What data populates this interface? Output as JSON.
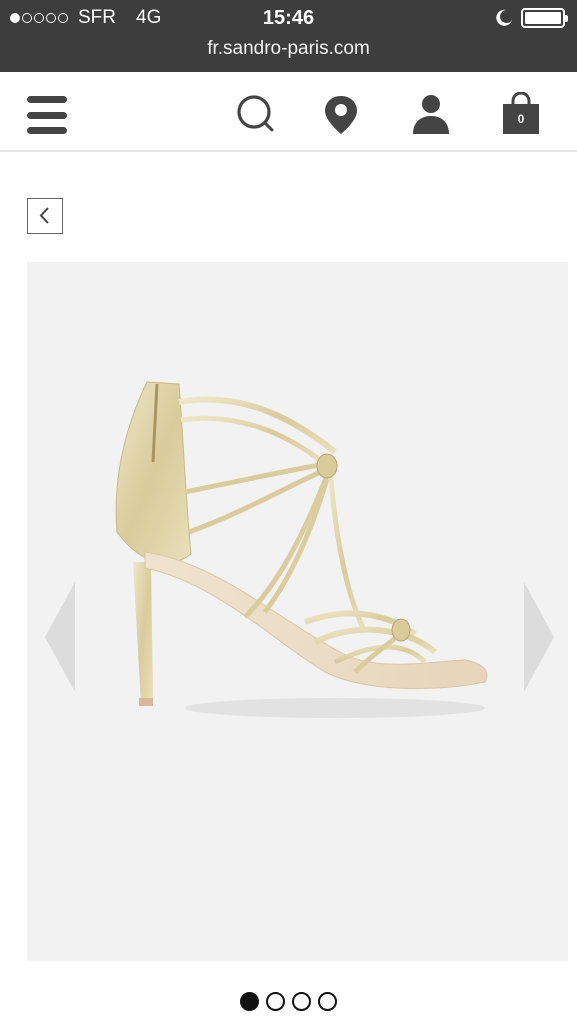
{
  "status_bar": {
    "signal_dots": [
      true,
      false,
      false,
      false,
      false
    ],
    "carrier": "SFR",
    "network": "4G",
    "time": "15:46",
    "do_not_disturb_icon": "moon-icon",
    "battery_level": 1.0
  },
  "browser": {
    "url": "fr.sandro-paris.com"
  },
  "header": {
    "menu_icon": "hamburger-menu-icon",
    "icons": [
      "search-icon",
      "store-locator-pin-icon",
      "account-icon",
      "shopping-bag-icon"
    ],
    "cart_count": "0"
  },
  "navigation": {
    "back_icon": "chevron-left-icon"
  },
  "gallery": {
    "image": "gold metallic strappy high-heel sandal",
    "prev_icon": "chevron-left-icon",
    "next_icon": "chevron-right-icon",
    "page_count": 4,
    "current_page": 1
  },
  "colors": {
    "status_bar_bg": "#3d3d3d",
    "icon_gray": "#444444",
    "gallery_bg": "#f2f2f2"
  }
}
